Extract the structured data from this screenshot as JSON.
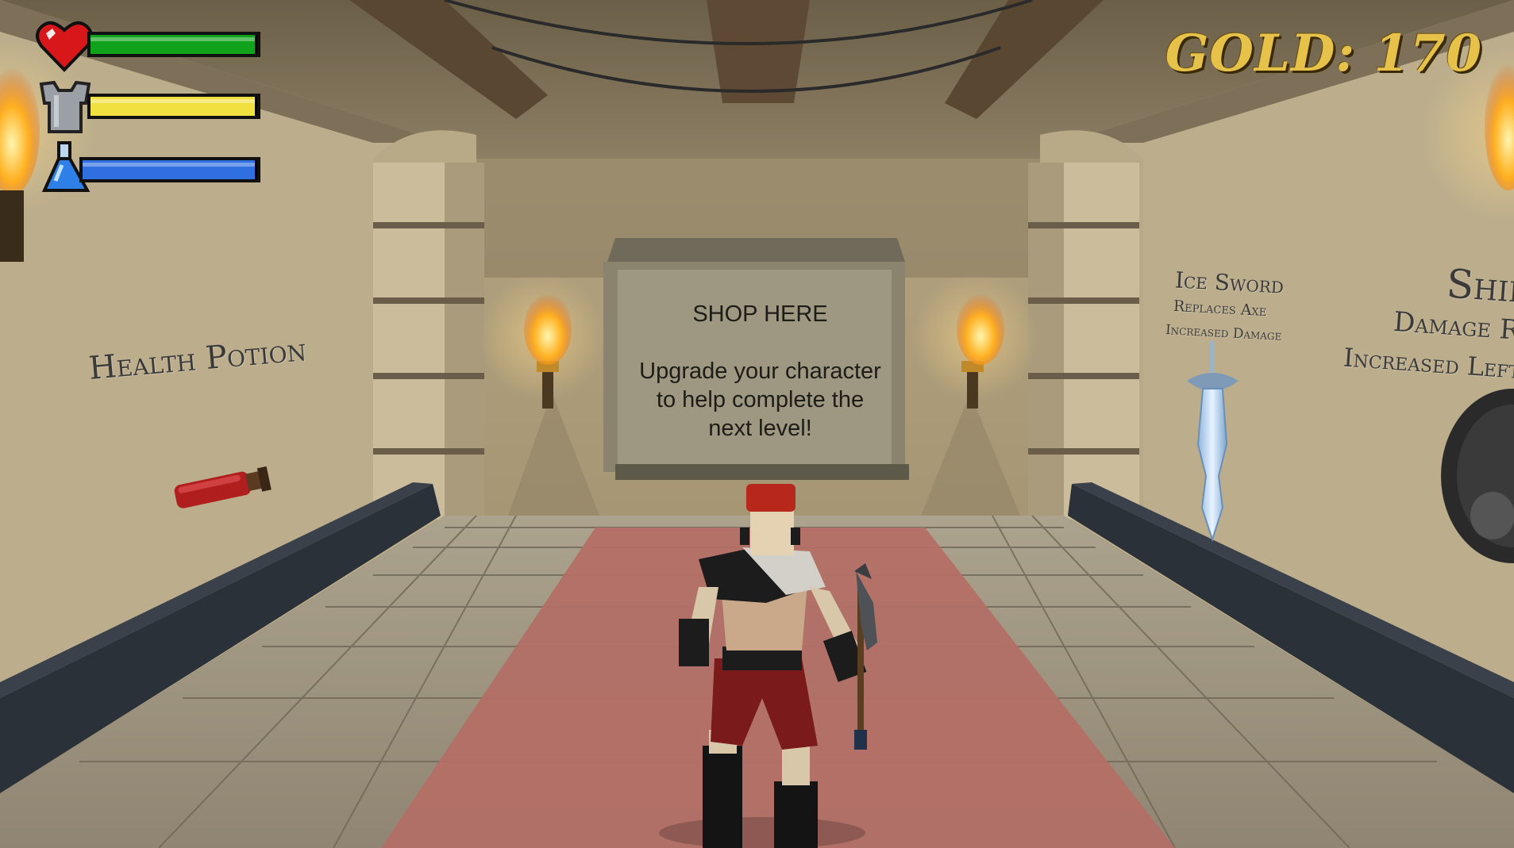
{
  "hud": {
    "health": {
      "icon": "heart-icon",
      "level": 1.0,
      "color": "#0fa21a"
    },
    "armor": {
      "icon": "chestplate-icon",
      "level": 1.0,
      "color": "#f0e040"
    },
    "mana": {
      "icon": "potion-flask-icon",
      "level": 1.0,
      "color": "#2f6fe0"
    },
    "gold_label": "GOLD: 170"
  },
  "sign": {
    "title": "SHOP HERE",
    "line1": "Upgrade your character",
    "line2": "to help complete the",
    "line3": "next level!"
  },
  "shop_items": {
    "health_potion": {
      "label": "Health Potion"
    },
    "ice_sword": {
      "label": "Ice Sword",
      "desc1": "Replaces Axe",
      "desc2": "Increased Damage"
    },
    "shield": {
      "label": "Shie",
      "desc1": "Damage Re",
      "desc2": "Increased Left I"
    }
  },
  "colors": {
    "wall": "#bdae8e",
    "floor": "#9b907c",
    "carpet": "#b5736b",
    "counter": "#2b3138",
    "gold": "#e6c24a"
  }
}
